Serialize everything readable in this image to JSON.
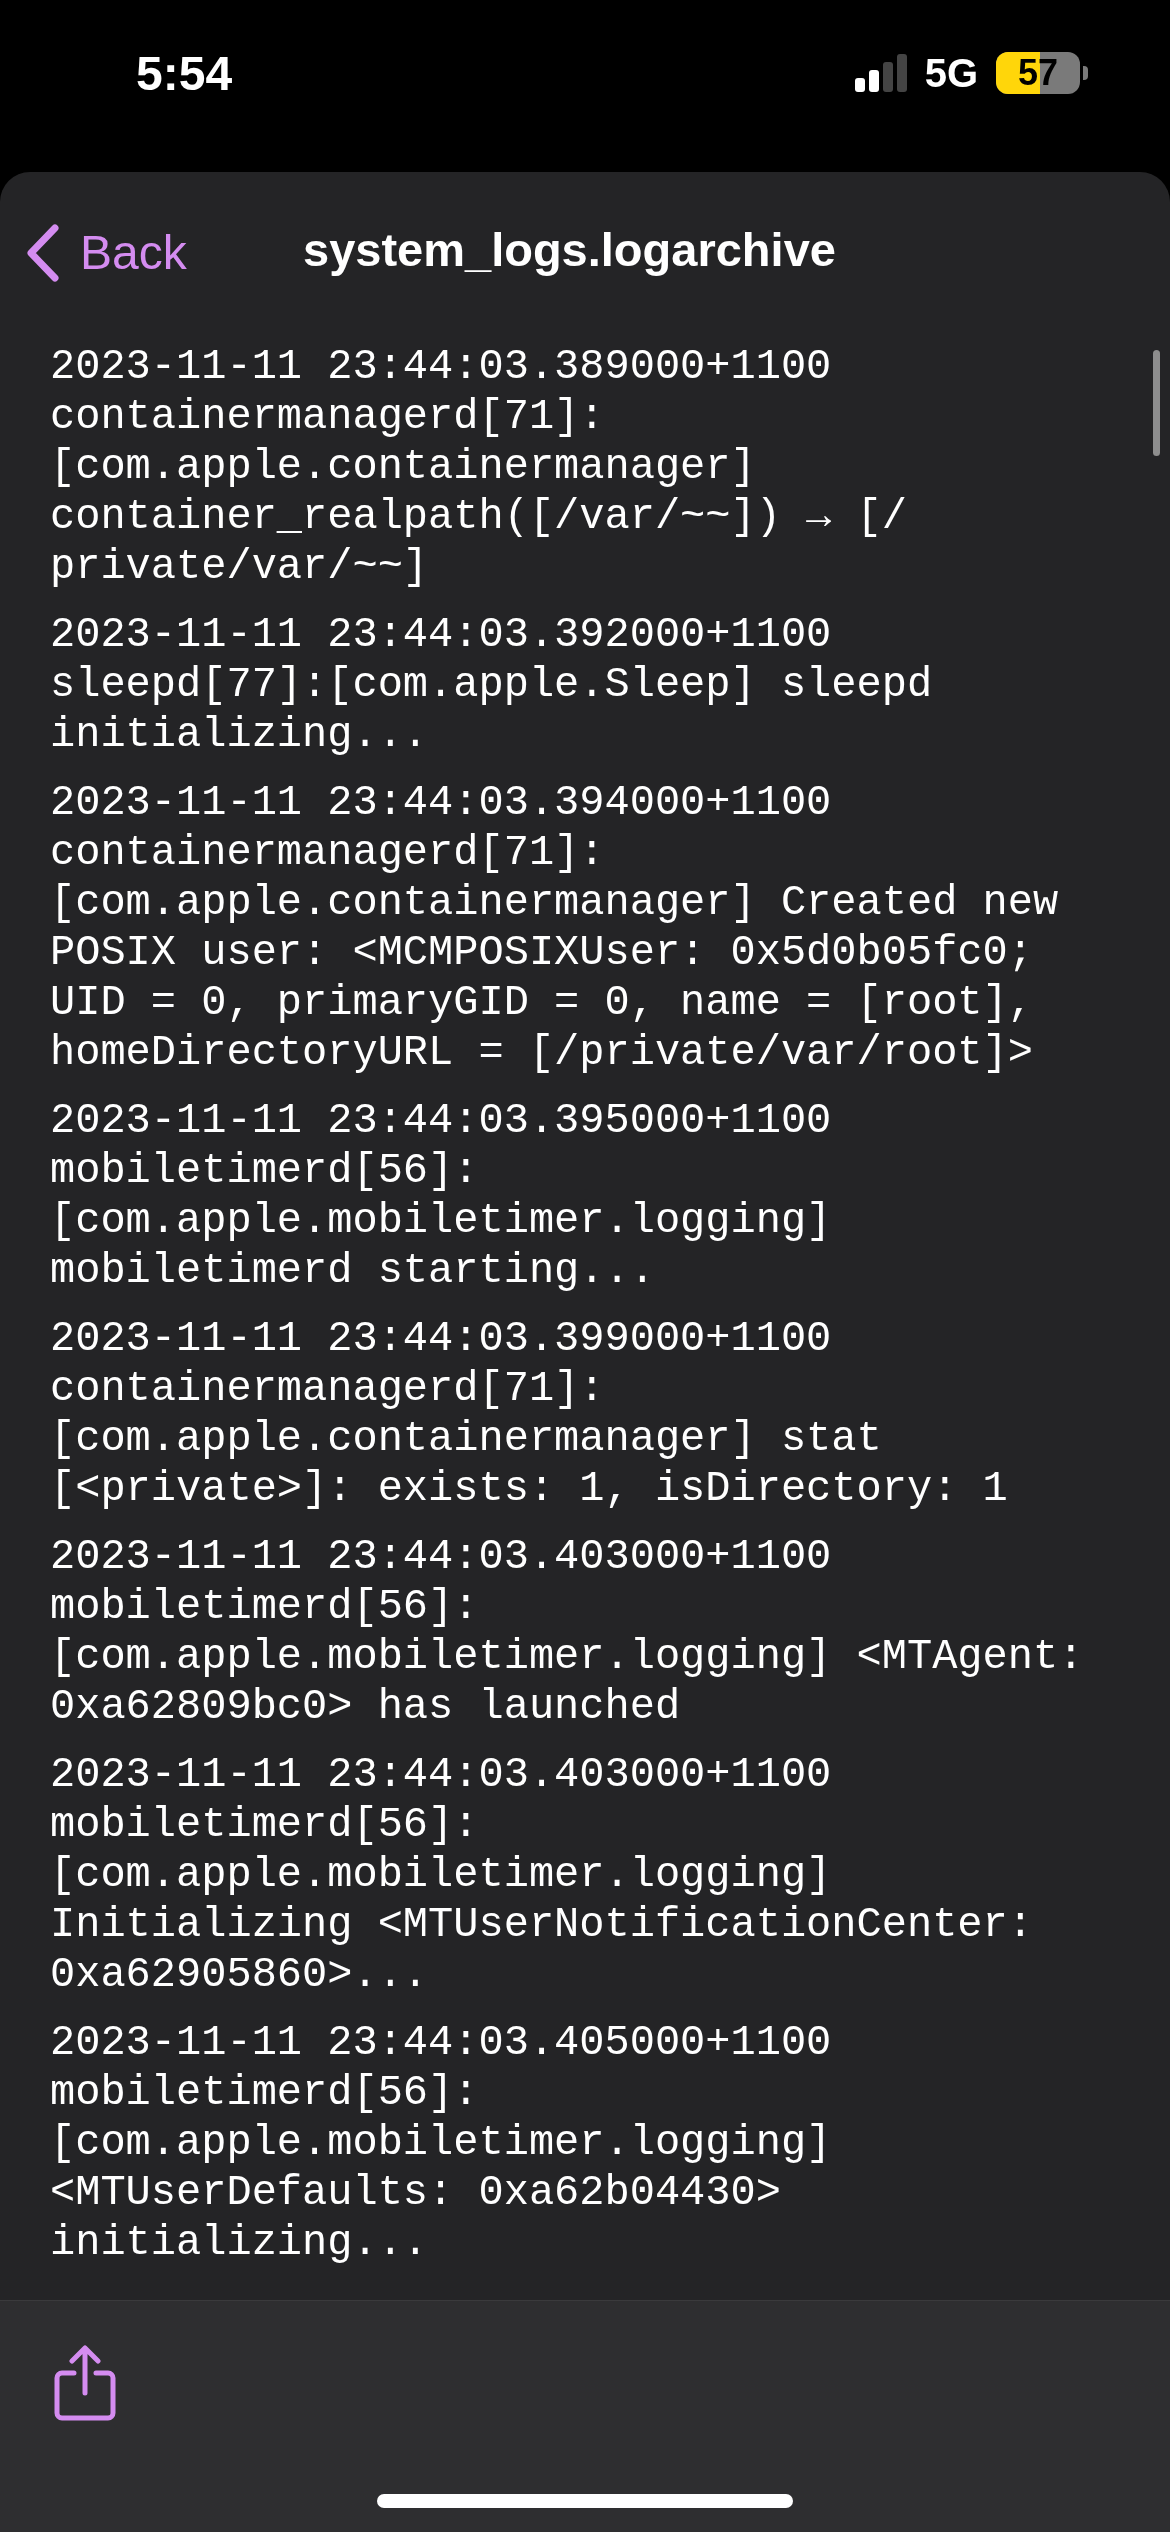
{
  "status_bar": {
    "time": "5:54",
    "network": "5G",
    "battery": "57"
  },
  "nav": {
    "back": "Back",
    "title": "system_logs.logarchive"
  },
  "log_entries": [
    "2023-11-11 23:44:03.389000+1100\ncontainermanagerd[71]:\n[com.apple.containermanager]\ncontainer_realpath([/var/~~]) → [/\nprivate/var/~~]",
    "2023-11-11 23:44:03.392000+1100\nsleepd[77]:[com.apple.Sleep] sleepd\ninitializing...",
    "2023-11-11 23:44:03.394000+1100\ncontainermanagerd[71]:\n[com.apple.containermanager] Created new\nPOSIX user: <MCMPOSIXUser: 0x5d0b05fc0;\nUID = 0, primaryGID = 0, name = [root],\nhomeDirectoryURL = [/private/var/root]>",
    "2023-11-11 23:44:03.395000+1100\nmobiletimerd[56]:\n[com.apple.mobiletimer.logging]\nmobiletimerd starting...",
    "2023-11-11 23:44:03.399000+1100\ncontainermanagerd[71]:\n[com.apple.containermanager] stat\n[<private>]: exists: 1, isDirectory: 1",
    "2023-11-11 23:44:03.403000+1100\nmobiletimerd[56]:\n[com.apple.mobiletimer.logging] <MTAgent:\n0xa62809bc0> has launched",
    "2023-11-11 23:44:03.403000+1100\nmobiletimerd[56]:\n[com.apple.mobiletimer.logging]\nInitializing <MTUserNotificationCenter:\n0xa62905860>...",
    "2023-11-11 23:44:03.405000+1100\nmobiletimerd[56]:\n[com.apple.mobiletimer.logging]\n<MTUserDefaults: 0xa62b04430>\ninitializing..."
  ]
}
